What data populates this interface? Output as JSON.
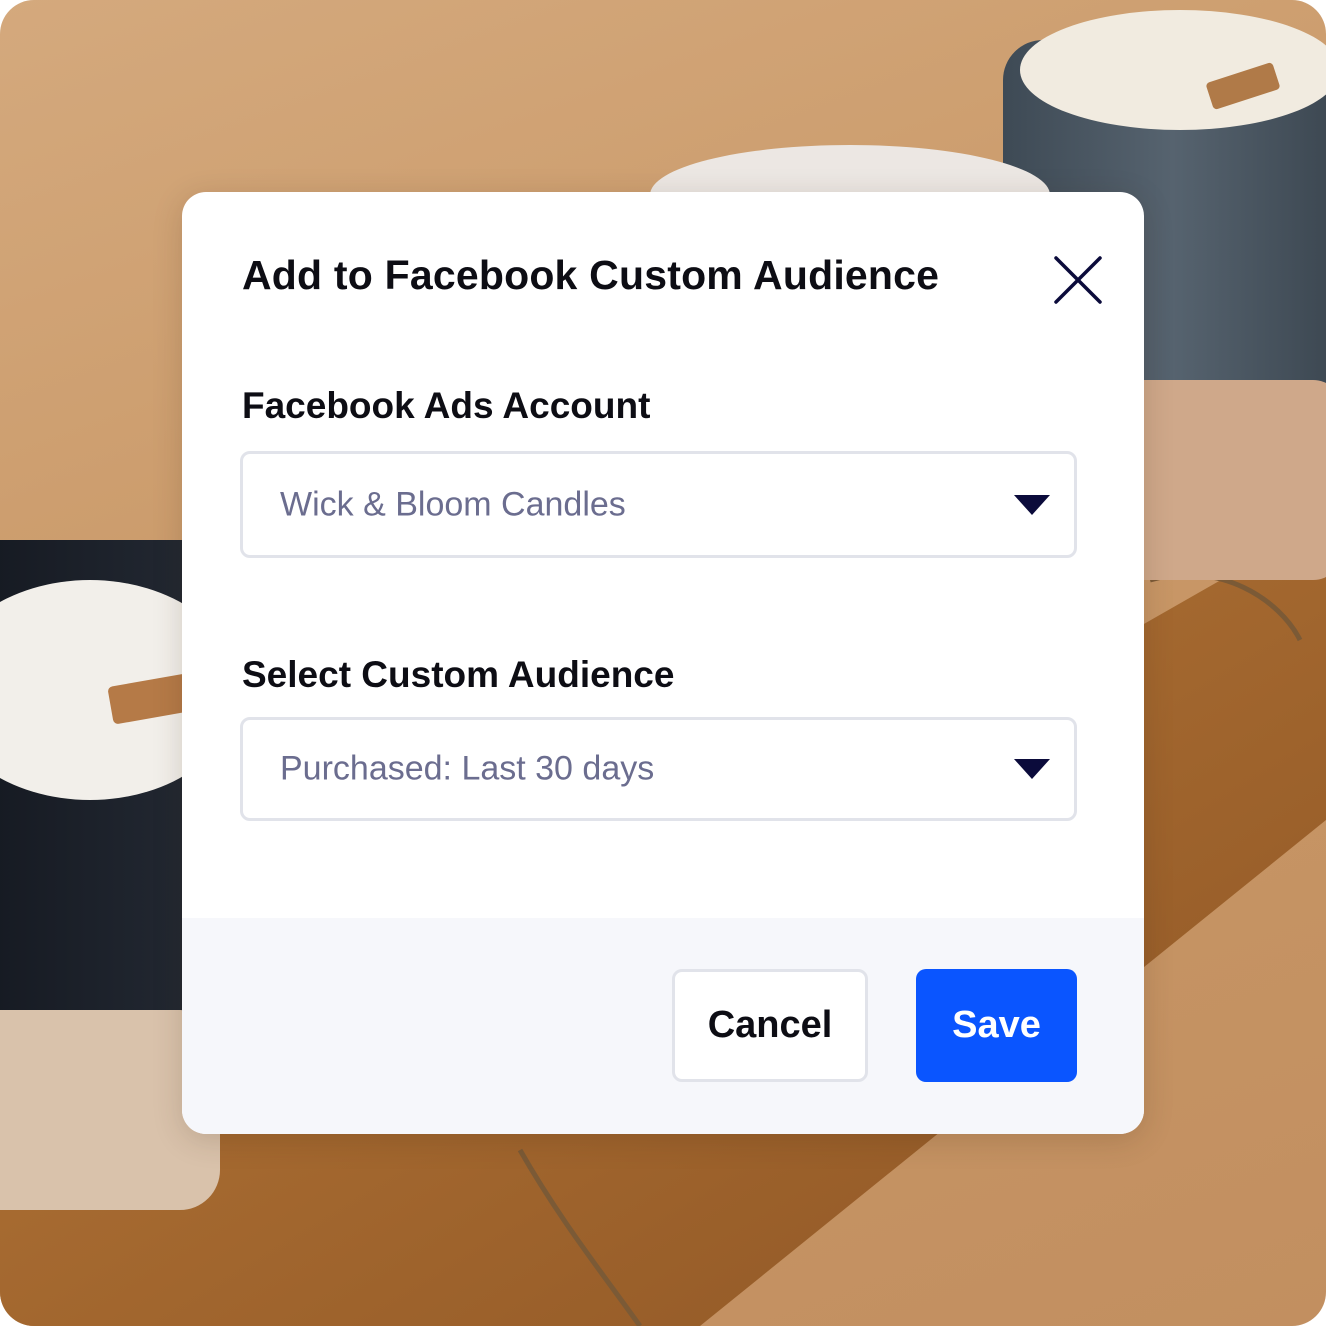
{
  "background": {
    "description_icon": "candles-photo",
    "colors": {
      "table": "#c99867",
      "accent": "#0a55ff"
    }
  },
  "modal": {
    "title": "Add to Facebook Custom Audience",
    "close_icon": "close-icon"
  },
  "ads_account": {
    "label": "Facebook Ads Account",
    "selected": "Wick & Bloom Candles"
  },
  "custom_audience": {
    "label": "Select Custom Audience",
    "selected": "Purchased: Last 30 days"
  },
  "actions": {
    "cancel_label": "Cancel",
    "save_label": "Save"
  }
}
